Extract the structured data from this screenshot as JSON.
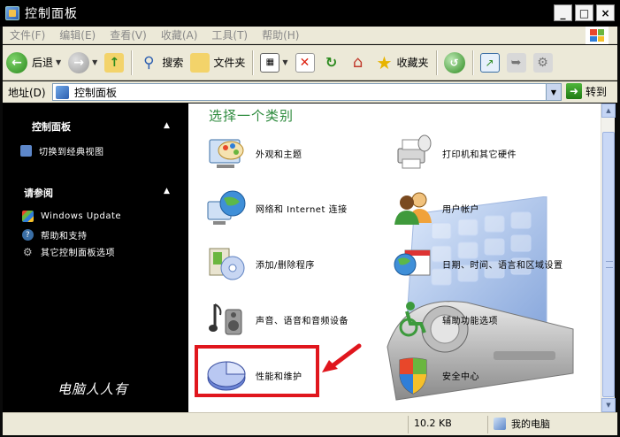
{
  "window": {
    "title": "控制面板",
    "buttons": [
      "_",
      "□",
      "×"
    ]
  },
  "menu": {
    "items": [
      "文件(F)",
      "编辑(E)",
      "查看(V)",
      "收藏(A)",
      "工具(T)",
      "帮助(H)"
    ]
  },
  "toolbar": {
    "back_label": "后退",
    "search_label": "搜索",
    "folders_label": "文件夹",
    "favorites_label": "收藏夹"
  },
  "address": {
    "label": "地址(D)",
    "value": "控制面板",
    "go_label": "转到"
  },
  "leftpane": {
    "section1_title": "控制面板",
    "switch_view": "切换到经典视图",
    "section2_title": "请参阅",
    "links": [
      "Windows Update",
      "帮助和支持",
      "其它控制面板选项"
    ],
    "watermark": "电脑人人有"
  },
  "main": {
    "heading": "选择一个类别",
    "categories": [
      {
        "label": "外观和主题",
        "icon": "appearance-icon"
      },
      {
        "label": "打印机和其它硬件",
        "icon": "printer-icon"
      },
      {
        "label": "网络和 Internet 连接",
        "icon": "network-icon"
      },
      {
        "label": "用户帐户",
        "icon": "users-icon"
      },
      {
        "label": "添加/删除程序",
        "icon": "add-remove-icon"
      },
      {
        "label": "日期、时间、语言和区域设置",
        "icon": "datetime-icon"
      },
      {
        "label": "声音、语音和音频设备",
        "icon": "sound-icon"
      },
      {
        "label": "辅助功能选项",
        "icon": "accessibility-icon"
      },
      {
        "label": "性能和维护",
        "icon": "performance-icon"
      },
      {
        "label": "安全中心",
        "icon": "security-icon"
      }
    ]
  },
  "status": {
    "size": "10.2 KB",
    "location": "我的电脑"
  },
  "colors": {
    "heading_green": "#2c8a3c",
    "highlight_red": "#e0161d"
  }
}
